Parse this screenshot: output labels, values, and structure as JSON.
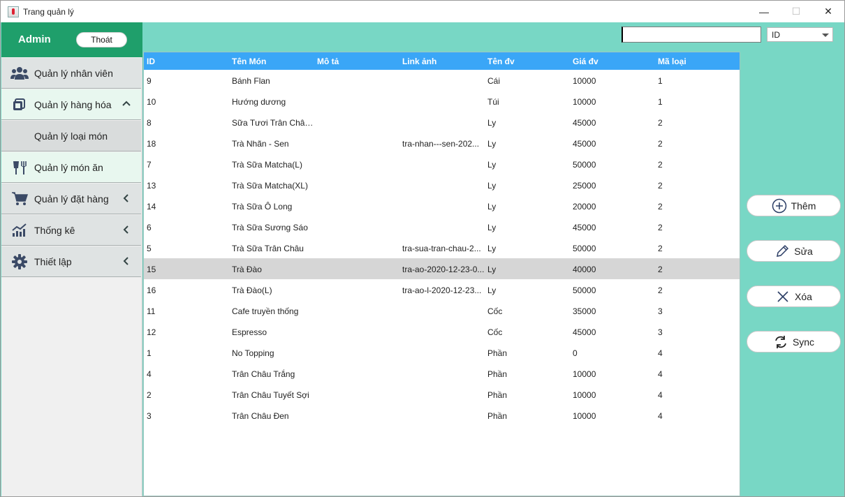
{
  "window": {
    "title": "Trang quản lý",
    "minimize_glyph": "—",
    "maximize_glyph": "☐",
    "close_glyph": "✕"
  },
  "sidebar": {
    "user": "Admin",
    "logout_label": "Thoát",
    "items": [
      {
        "label": "Quản lý nhân viên",
        "icon": "users-icon"
      },
      {
        "label": "Quản lý hàng hóa",
        "icon": "box-icon",
        "chevron": "up"
      },
      {
        "label": "Quản lý loại món",
        "sub": true
      },
      {
        "label": "Quản lý món ăn",
        "icon": "food-icon"
      },
      {
        "label": "Quản lý đặt hàng",
        "icon": "cart-icon",
        "chevron": "left"
      },
      {
        "label": "Thống kê",
        "icon": "chart-icon",
        "chevron": "left"
      },
      {
        "label": "Thiết lập",
        "icon": "gear-icon",
        "chevron": "left"
      }
    ]
  },
  "search": {
    "value": "",
    "filter_selected": "ID"
  },
  "table": {
    "columns": [
      "ID",
      "Tên Món",
      "Mô tả",
      "Link ảnh",
      "Tên đv",
      "Giá đv",
      "Mã loại"
    ],
    "rows": [
      [
        "9",
        "Bánh Flan",
        "",
        "",
        "Cái",
        "10000",
        "1"
      ],
      [
        "10",
        "Hướng dương",
        "",
        "",
        "Túi",
        "10000",
        "1"
      ],
      [
        "8",
        "Sữa Tươi Trân Châu ...",
        "",
        "",
        "Ly",
        "45000",
        "2"
      ],
      [
        "18",
        "Trà Nhãn - Sen",
        "",
        "tra-nhan---sen-202...",
        "Ly",
        "45000",
        "2"
      ],
      [
        "7",
        "Trà Sữa Matcha(L)",
        "",
        "",
        "Ly",
        "50000",
        "2"
      ],
      [
        "13",
        "Trà Sữa Matcha(XL)",
        "",
        "",
        "Ly",
        "25000",
        "2"
      ],
      [
        "14",
        "Trà Sữa Ô Long",
        "",
        "",
        "Ly",
        "20000",
        "2"
      ],
      [
        "6",
        "Trà Sữa Sương Sáo",
        "",
        "",
        "Ly",
        "45000",
        "2"
      ],
      [
        "5",
        "Trà Sữa Trân Châu",
        "",
        "tra-sua-tran-chau-2...",
        "Ly",
        "50000",
        "2"
      ],
      [
        "15",
        "Trà Đào",
        "",
        "tra-ao-2020-12-23-0...",
        "Ly",
        "40000",
        "2"
      ],
      [
        "16",
        "Trà Đào(L)",
        "",
        "tra-ao-l-2020-12-23...",
        "Ly",
        "50000",
        "2"
      ],
      [
        "11",
        "Cafe truyền thống",
        "",
        "",
        "Cốc",
        "35000",
        "3"
      ],
      [
        "12",
        "Espresso",
        "",
        "",
        "Cốc",
        "45000",
        "3"
      ],
      [
        "1",
        "No Topping",
        "",
        "",
        "Phần",
        "0",
        "4"
      ],
      [
        "4",
        "Trân Châu Trắng",
        "",
        "",
        "Phần",
        "10000",
        "4"
      ],
      [
        "2",
        "Trân Châu Tuyết Sợi",
        "",
        "",
        "Phần",
        "10000",
        "4"
      ],
      [
        "3",
        "Trân Châu Đen",
        "",
        "",
        "Phần",
        "10000",
        "4"
      ]
    ],
    "selected_row": 9
  },
  "actions": {
    "add_label": "Thêm",
    "edit_label": "Sửa",
    "delete_label": "Xóa",
    "sync_label": "Sync"
  },
  "colors": {
    "background": "#78d7c5",
    "header_green": "#1f9f6b",
    "table_header": "#3aa6f7",
    "selected_row": "#d6d6d6",
    "icon_blue": "#3b4a66"
  }
}
